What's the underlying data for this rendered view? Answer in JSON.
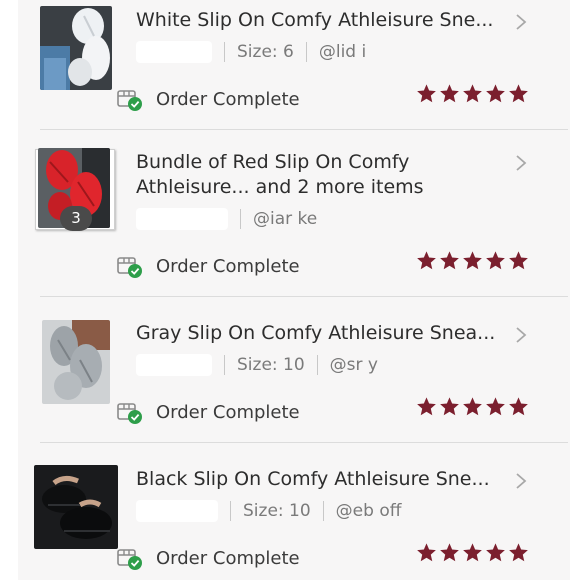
{
  "orders": [
    {
      "title": "White Slip On Comfy Athleisure Sne...",
      "size": "Size: 6",
      "handle": "@lid     i",
      "status": "Order Complete",
      "rating": 5
    },
    {
      "title": "Bundle of Red Slip On Comfy Athleisure... and 2 more items",
      "item_count": "3",
      "handle": "@iar      ke",
      "status": "Order Complete",
      "rating": 5
    },
    {
      "title": "Gray Slip On Comfy Athleisure Snea...",
      "size": "Size: 10",
      "handle": "@sr        y",
      "status": "Order Complete",
      "rating": 5
    },
    {
      "title": "Black Slip On Comfy Athleisure Sne...",
      "size": "Size: 10",
      "handle": "@eb      off",
      "status": "Order Complete",
      "rating": 5
    }
  ],
  "colors": {
    "star": "#7b1f2e",
    "check": "#2e9e4a",
    "chevron": "#a8a8a8"
  },
  "icons": {
    "status": "package-check-icon",
    "chevron": "chevron-right-icon",
    "star": "star-icon"
  }
}
